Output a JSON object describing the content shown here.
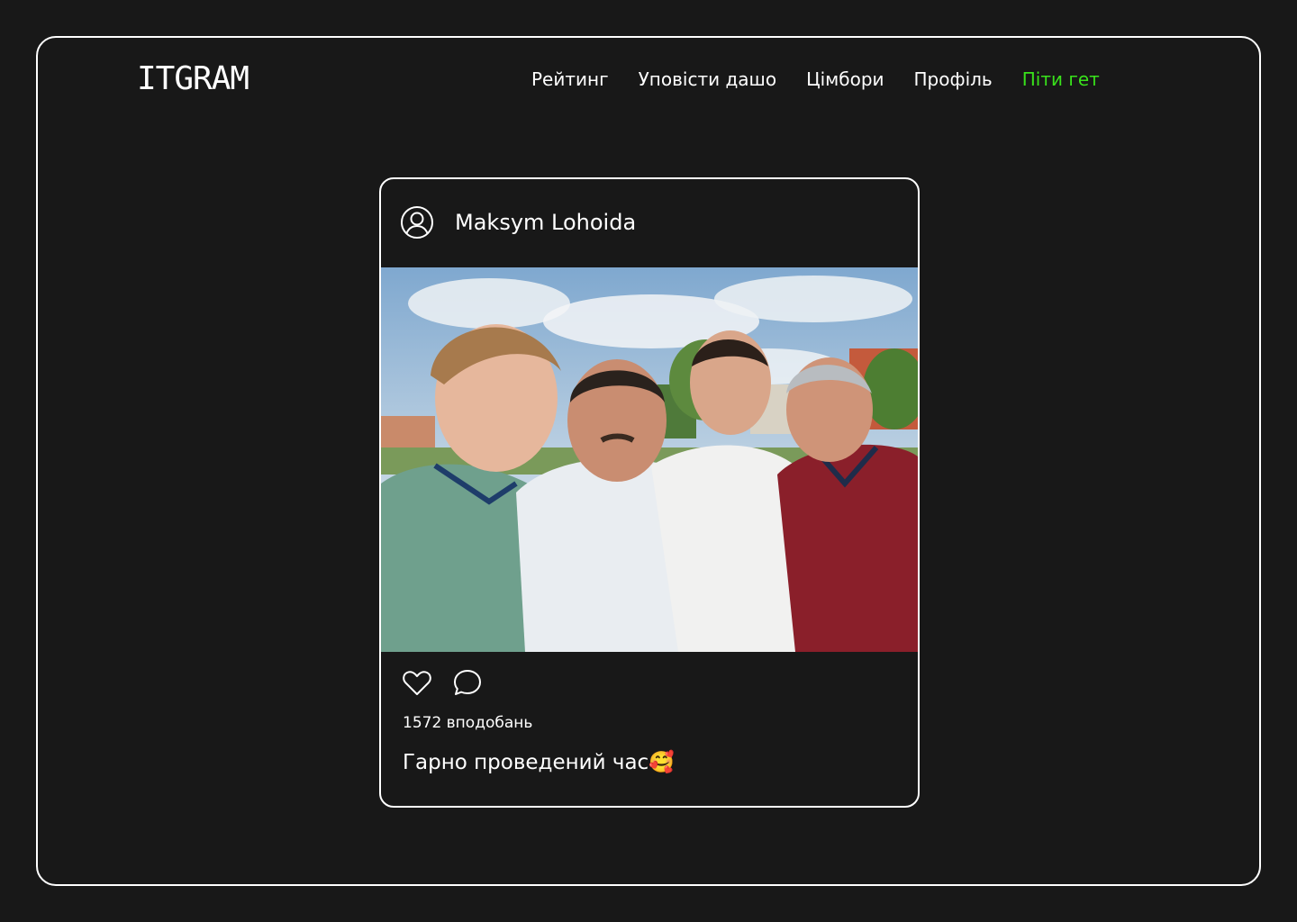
{
  "app": {
    "logo_text": "ITGRAM"
  },
  "nav": {
    "items": [
      {
        "label": "Рейтинг"
      },
      {
        "label": "Уповісти дашо"
      },
      {
        "label": "Цімбори"
      },
      {
        "label": "Профіль"
      },
      {
        "label": "Піти гет"
      }
    ]
  },
  "post": {
    "author": "Maksym Lohoida",
    "avatar_icon": "user-circle-icon",
    "photo_description_icon": "group-photo",
    "like_icon": "heart-icon",
    "comment_icon": "comment-bubble-icon",
    "likes_text": "1572 вподобань",
    "caption": "Гарно проведений час🥰"
  },
  "colors": {
    "background": "#181818",
    "border": "#ffffff",
    "text": "#ffffff",
    "accent": "#39e21b"
  }
}
